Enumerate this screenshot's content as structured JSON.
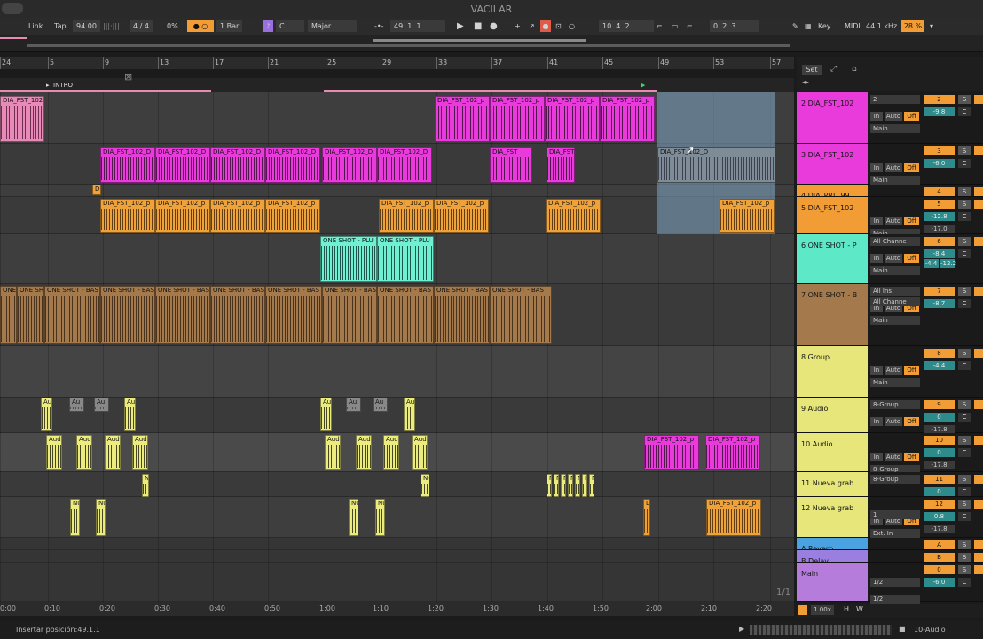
{
  "window": {
    "title": "VACILAR"
  },
  "toolbar": {
    "link": "Link",
    "tap": "Tap",
    "tempo": "94.00",
    "time_signature": "4 / 4",
    "groove_percent": "0%",
    "quantize": "1 Bar",
    "key_root": "C",
    "scale": "Major",
    "arrangement_position": "49.  1.  1",
    "loop_start": "10.  4.  2",
    "loop_length": "0.  2.  3",
    "key_map": "Key",
    "midi_map": "MIDI",
    "sample_rate": "44.1 kHz",
    "cpu_load": "28 %"
  },
  "ruler": {
    "bars": [
      "24",
      "5",
      "9",
      "13",
      "17",
      "21",
      "25",
      "29",
      "33",
      "37",
      "41",
      "45",
      "49",
      "53",
      "57"
    ]
  },
  "locator": {
    "name": "INTRO"
  },
  "panel_header": {
    "set": "Set"
  },
  "clip_labels": {
    "dia": "DIA_FST_102_p",
    "dia_short": "DIA_FST_102_D",
    "dia_a": "DIA_FST",
    "dia_prl": "D",
    "one_shot_plu": "ONE SHOT - PLU",
    "one_shot_bas": "ONE SHOT - BAS",
    "audio": "Au",
    "audio2": "Audi",
    "nueva": "Nu",
    "dia_plain": "DIA_FST_102_p"
  },
  "tracks": [
    {
      "name": "2 DIA_FST_102",
      "color": "#e93adc",
      "num": "2",
      "vol": "-9.8",
      "io": "Main",
      "arm": "2"
    },
    {
      "name": "3 DIA_FST_102",
      "color": "#e93adc",
      "num": "3",
      "vol": "-6.0",
      "io": "Main"
    },
    {
      "name": "4 DIA_PRL_99",
      "color": "#f19c34",
      "num": "4"
    },
    {
      "name": "5 DIA_FST_102",
      "color": "#f19c34",
      "num": "5",
      "vol": "-12.8",
      "io": "Main",
      "extra": "-17.0"
    },
    {
      "name": "6 ONE SHOT - P",
      "color": "#5de8c8",
      "num": "6",
      "vol": "-8.4",
      "io": "Main",
      "input": "All Channe",
      "pan": "-4.4",
      "pan2": "-12.2"
    },
    {
      "name": "7 ONE SHOT - B",
      "color": "#a47a4c",
      "num": "7",
      "vol": "-8.7",
      "io": "Main",
      "input": "All Ins",
      "input2": "All Channe"
    },
    {
      "name": "8 Group",
      "color": "#e6e67a",
      "num": "8",
      "vol": "-4.4",
      "io": "Main"
    },
    {
      "name": "9 Audio",
      "color": "#e6e67a",
      "num": "9",
      "vol": "0",
      "io": "8-Group",
      "extra": "-17.8"
    },
    {
      "name": "10 Audio",
      "color": "#e6e67a",
      "num": "10",
      "vol": "0",
      "io": "8-Group",
      "extra": "-17.8"
    },
    {
      "name": "11 Nueva grab",
      "color": "#e6e67a",
      "num": "11",
      "vol": "0",
      "io": "8-Group"
    },
    {
      "name": "12 Nueva grab",
      "color": "#e6e67a",
      "num": "12",
      "vol": "0.8",
      "io": "Ext. In",
      "input2": "1",
      "extra": "-17.8"
    },
    {
      "name": "A Reverb",
      "color": "#4aa3e0",
      "num": "A"
    },
    {
      "name": "B Delay",
      "color": "#9a7ee0",
      "num": "B"
    },
    {
      "name": "Main",
      "color": "#b57cdb",
      "num": "0",
      "io": "1/2",
      "io2": "1/2",
      "vol": "-6.0"
    }
  ],
  "common": {
    "in": "In",
    "auto": "Auto",
    "off": "Off",
    "s": "S",
    "c": "C",
    "inf": "-∞",
    "po": "Po"
  },
  "scroll_page": "1/1",
  "zoom": "1.00x",
  "hw": {
    "h": "H",
    "w": "W"
  },
  "time_ticks": [
    "0:00",
    "0:10",
    "0:20",
    "0:30",
    "0:40",
    "0:50",
    "1:00",
    "1:10",
    "1:20",
    "1:30",
    "1:40",
    "1:50",
    "2:00",
    "2:10",
    "2:20"
  ],
  "status": {
    "insert_position": "Insertar posición:49.1.1",
    "selected_track": "10-Audio"
  }
}
